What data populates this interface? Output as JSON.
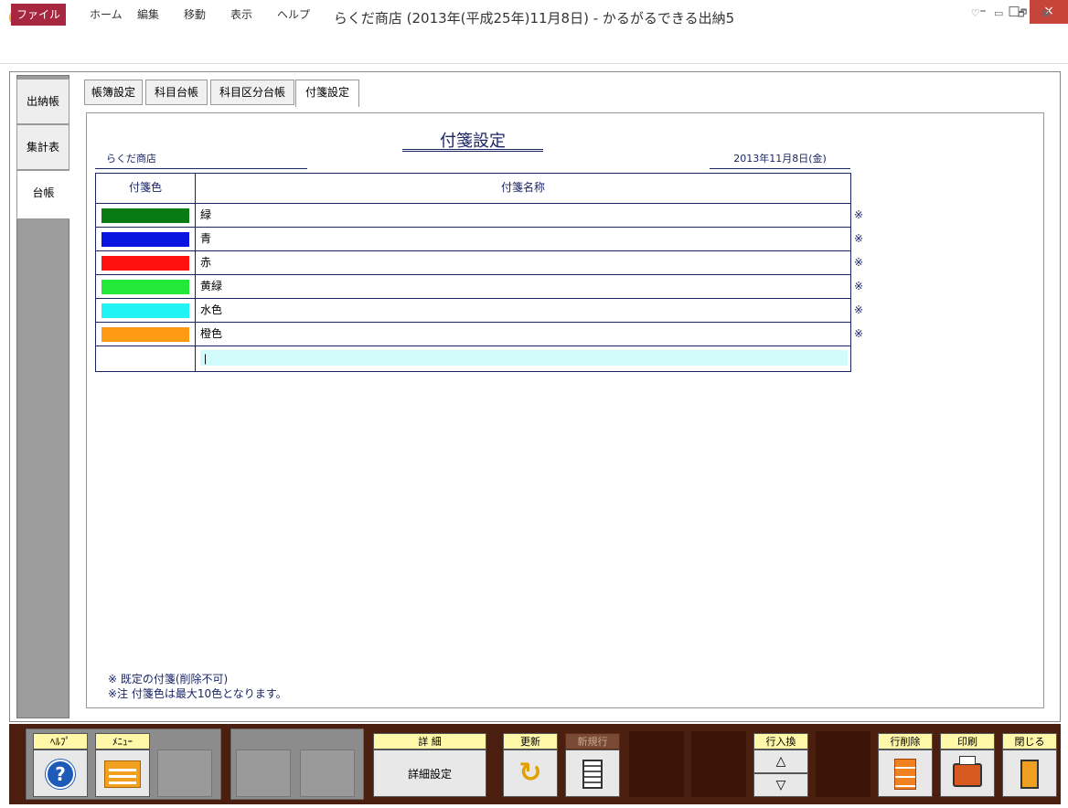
{
  "window": {
    "title": "らくだ商店 (2013年(平成25年)11月8日) - かるがるできる出納5",
    "qa_sep": "||▾",
    "min": "–",
    "max": "□",
    "close": "×"
  },
  "menu": {
    "file": "ファイル",
    "items": [
      "ホーム",
      "編集",
      "移動",
      "表示",
      "ヘルプ"
    ],
    "ribbon_controls": "♡ ▭ 🗗 ⊠"
  },
  "left_tabs": [
    "出納帳",
    "集計表",
    "台帳"
  ],
  "top_tabs": [
    "帳簿設定",
    "科目台帳",
    "科目区分台帳",
    "付箋設定"
  ],
  "doc": {
    "title": "付箋設定",
    "company": "らくだ商店",
    "date": "2013年11月8日(金)"
  },
  "grid": {
    "col_color": "付箋色",
    "col_name": "付箋名称",
    "rows": [
      {
        "color": "#0a7a14",
        "name": "緑",
        "mark": "※"
      },
      {
        "color": "#0a14e0",
        "name": "青",
        "mark": "※"
      },
      {
        "color": "#ff1010",
        "name": "赤",
        "mark": "※"
      },
      {
        "color": "#22e83a",
        "name": "黄緑",
        "mark": "※"
      },
      {
        "color": "#22f4f4",
        "name": "水色",
        "mark": "※"
      },
      {
        "color": "#ff9a14",
        "name": "橙色",
        "mark": "※"
      }
    ],
    "new_row_value": "|"
  },
  "notes": {
    "line1": "※ 既定の付箋(削除不可)",
    "line2": "※注 付箋色は最大10色となります。"
  },
  "toolbar": {
    "help": "ﾍﾙﾌﾟ",
    "menu": "ﾒﾆｭｰ",
    "detail": "詳 細",
    "detail_btn": "詳細設定",
    "update": "更新",
    "newrow": "新規行",
    "rowswap": "行入換",
    "rowdel": "行削除",
    "print": "印刷",
    "close": "閉じる",
    "help_icon": "?",
    "update_icon": "↻",
    "up": "△",
    "down": "▽"
  }
}
